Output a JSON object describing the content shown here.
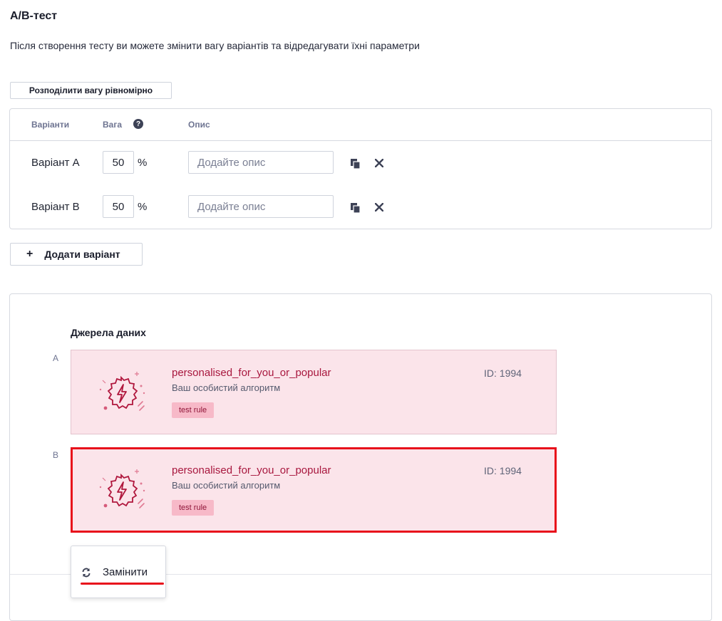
{
  "header": {
    "title": "A/B-тест",
    "subtitle": "Після створення тесту ви можете змінити вагу варіантів та відредагувати їхні параметри"
  },
  "toolbar": {
    "distribute_label": "Розподілити вагу рівномірно",
    "add_variant_plus": "+",
    "add_variant_label": "Додати варіант"
  },
  "variants_table": {
    "columns": [
      "Варіанти",
      "Вага",
      "Опис"
    ],
    "help_glyph": "?",
    "rows": [
      {
        "name": "Варіант A",
        "weight": "50",
        "unit": "%",
        "description_placeholder": "Додайте опис"
      },
      {
        "name": "Варіант B",
        "weight": "50",
        "unit": "%",
        "description_placeholder": "Додайте опис"
      }
    ],
    "row_icons": [
      "copy-icon",
      "close-icon"
    ]
  },
  "data_sources": {
    "title": "Джерела даних",
    "cards": [
      {
        "letter": "A",
        "name": "personalised_for_you_or_popular",
        "subtitle": "Ваш особистий алгоритм",
        "id_text": "ID: 1994",
        "tag": "test rule",
        "icon": "lightning-badge-icon",
        "selected": false
      },
      {
        "letter": "B",
        "name": "personalised_for_you_or_popular",
        "subtitle": "Ваш особистий алгоритм",
        "id_text": "ID: 1994",
        "tag": "test rule",
        "icon": "lightning-badge-icon",
        "selected": true
      }
    ]
  },
  "context_menu": {
    "replace_label": "Замінити",
    "replace_icon": "refresh-icon"
  },
  "colors": {
    "card_bg": "#fbe4ea",
    "card_text": "#a8173e",
    "tag_bg": "#f7b9c8",
    "highlight": "#e8101b"
  }
}
